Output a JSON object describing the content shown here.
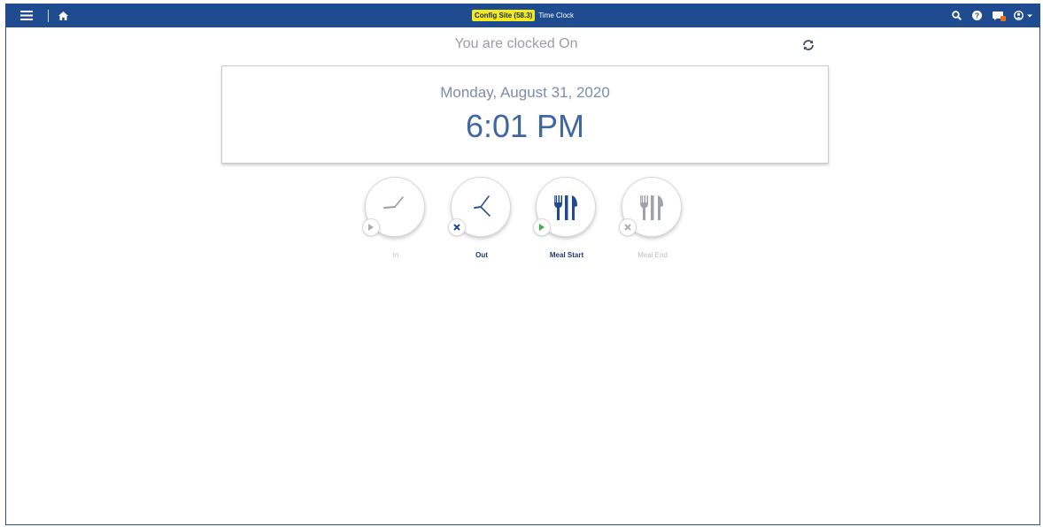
{
  "topbar": {
    "site_badge": "Config Site (58.3)",
    "page_title": "Time Clock",
    "icons": [
      "menu-icon",
      "home-icon",
      "search-icon",
      "help-icon",
      "notifications-icon",
      "user-icon"
    ]
  },
  "status": {
    "clocked_text": "You are clocked On",
    "refresh_icon": "refresh-icon"
  },
  "clock": {
    "date": "Monday, August 31, 2020",
    "time": "6:01 PM"
  },
  "punches": [
    {
      "label": "In",
      "icon": "clock-in-icon",
      "badge": "play-icon",
      "enabled": false
    },
    {
      "label": "Out",
      "icon": "clock-out-icon",
      "badge": "close-icon",
      "enabled": true
    },
    {
      "label": "Meal Start",
      "icon": "utensils-icon",
      "badge": "play-icon",
      "enabled": true
    },
    {
      "label": "Meal End",
      "icon": "utensils-icon",
      "badge": "close-icon",
      "enabled": false
    }
  ],
  "colors": {
    "header_bg": "#1f4b90",
    "badge_bg": "#f2ea1d",
    "accent_blue": "#1f4b90",
    "play_green": "#3cb34a",
    "disabled_gray": "#a9adb4"
  }
}
